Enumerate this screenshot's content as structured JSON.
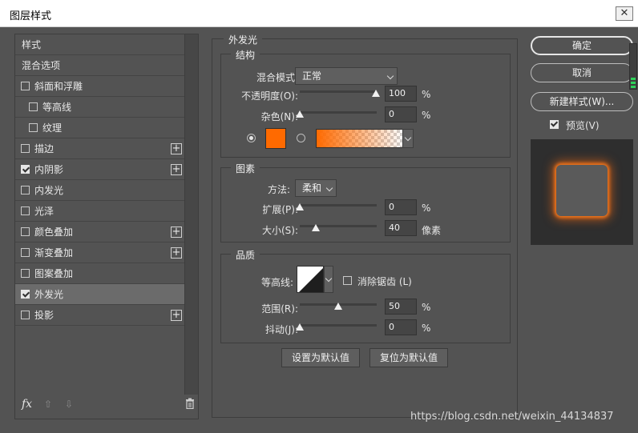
{
  "window": {
    "title": "图层样式",
    "close": "✕"
  },
  "left": {
    "items": [
      {
        "label": "样式"
      },
      {
        "label": "混合选项"
      },
      {
        "label": "斜面和浮雕"
      },
      {
        "label": "等高线"
      },
      {
        "label": "纹理"
      },
      {
        "label": "描边",
        "plus": "+"
      },
      {
        "label": "内阴影",
        "plus": "+"
      },
      {
        "label": "内发光"
      },
      {
        "label": "光泽"
      },
      {
        "label": "颜色叠加",
        "plus": "+"
      },
      {
        "label": "渐变叠加",
        "plus": "+"
      },
      {
        "label": "图案叠加"
      },
      {
        "label": "外发光"
      },
      {
        "label": "投影",
        "plus": "+"
      }
    ],
    "bottom": {
      "fx": "fx",
      "up": "⇧",
      "down": "⇩"
    }
  },
  "main": {
    "title": "外发光",
    "structure": {
      "title": "结构",
      "blend_label": "混合模式:",
      "blend_value": "正常",
      "opacity_label": "不透明度(O):",
      "opacity_value": "100",
      "opacity_unit": "%",
      "noise_label": "杂色(N):",
      "noise_value": "0",
      "noise_unit": "%",
      "color": "#ff6a00"
    },
    "elements": {
      "title": "图素",
      "method_label": "方法:",
      "method_value": "柔和",
      "spread_label": "扩展(P):",
      "spread_value": "0",
      "spread_unit": "%",
      "size_label": "大小(S):",
      "size_value": "40",
      "size_unit": "像素"
    },
    "quality": {
      "title": "品质",
      "contour_label": "等高线:",
      "antialias_label": "消除锯齿 (L)",
      "range_label": "范围(R):",
      "range_value": "50",
      "range_unit": "%",
      "jitter_label": "抖动(J):",
      "jitter_value": "0",
      "jitter_unit": "%"
    },
    "buttons": {
      "set_default": "设置为默认值",
      "reset_default": "复位为默认值"
    }
  },
  "right": {
    "ok": "确定",
    "cancel": "取消",
    "new_style": "新建样式(W)...",
    "preview": "预览(V)"
  },
  "watermark": "https://blog.csdn.net/weixin_44134837"
}
